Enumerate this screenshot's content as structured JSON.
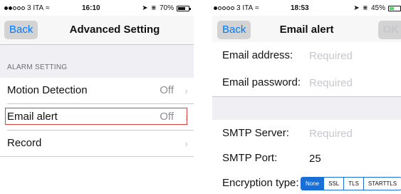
{
  "left": {
    "status": {
      "carrier": "3 ITA",
      "time": "16:10",
      "battery": "70%",
      "battery_level": 0.7
    },
    "nav": {
      "back_label": "Back",
      "title": "Advanced Setting"
    },
    "section_header": "ALARM SETTING",
    "rows": [
      {
        "label": "Motion Detection",
        "value": "Off"
      },
      {
        "label": "Email alert",
        "value": "Off"
      },
      {
        "label": "Record",
        "value": ""
      }
    ]
  },
  "right": {
    "status": {
      "carrier": "3 ITA",
      "time": "18:53",
      "battery": "45%",
      "battery_level": 0.45
    },
    "nav": {
      "back_label": "Back",
      "title": "Email alert",
      "ok_label": "OK"
    },
    "fields": {
      "email_address": {
        "label": "Email address:",
        "placeholder": "Required"
      },
      "email_password": {
        "label": "Email password:",
        "placeholder": "Required"
      },
      "smtp_server": {
        "label": "SMTP Server:",
        "placeholder": "Required"
      },
      "smtp_port": {
        "label": "SMTP Port:",
        "value": "25"
      },
      "encryption": {
        "label": "Encryption type:",
        "options": [
          "None",
          "SSL",
          "TLS",
          "STARTTLS"
        ],
        "selected": "None"
      }
    }
  },
  "colors": {
    "accent": "#007aff",
    "segment": "#1a6fd6",
    "highlight": "#d9413c"
  },
  "chevron": "›"
}
